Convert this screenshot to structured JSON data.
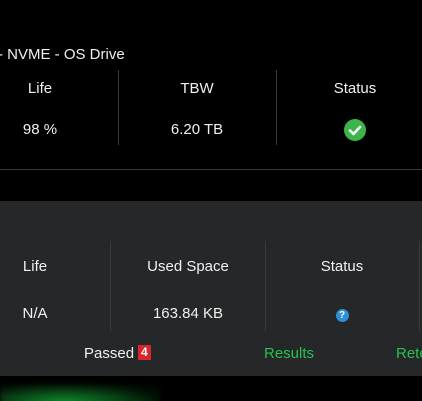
{
  "drive1": {
    "title": "- NVME - OS Drive",
    "columns": {
      "life": {
        "header": "Life",
        "value": "98 %"
      },
      "tbw": {
        "header": "TBW",
        "value": "6.20 TB"
      },
      "status": {
        "header": "Status",
        "icon": "check-circle-icon",
        "state": "ok"
      }
    }
  },
  "drive2": {
    "columns": {
      "life": {
        "header": "Life",
        "value": "N/A"
      },
      "used_space": {
        "header": "Used Space",
        "value": "163.84 KB"
      },
      "status": {
        "header": "Status",
        "icon": "help-circle-icon",
        "glyph": "?"
      }
    },
    "footer": {
      "passed_label": "Passed",
      "passed_count": "4",
      "results_link": "Results",
      "retest_link": "Rete"
    }
  },
  "colors": {
    "ok_green": "#3bb54a",
    "link_green": "#27c24c",
    "badge_red": "#d8262c",
    "help_blue": "#2f8fd8",
    "panel_gray": "#262728"
  }
}
